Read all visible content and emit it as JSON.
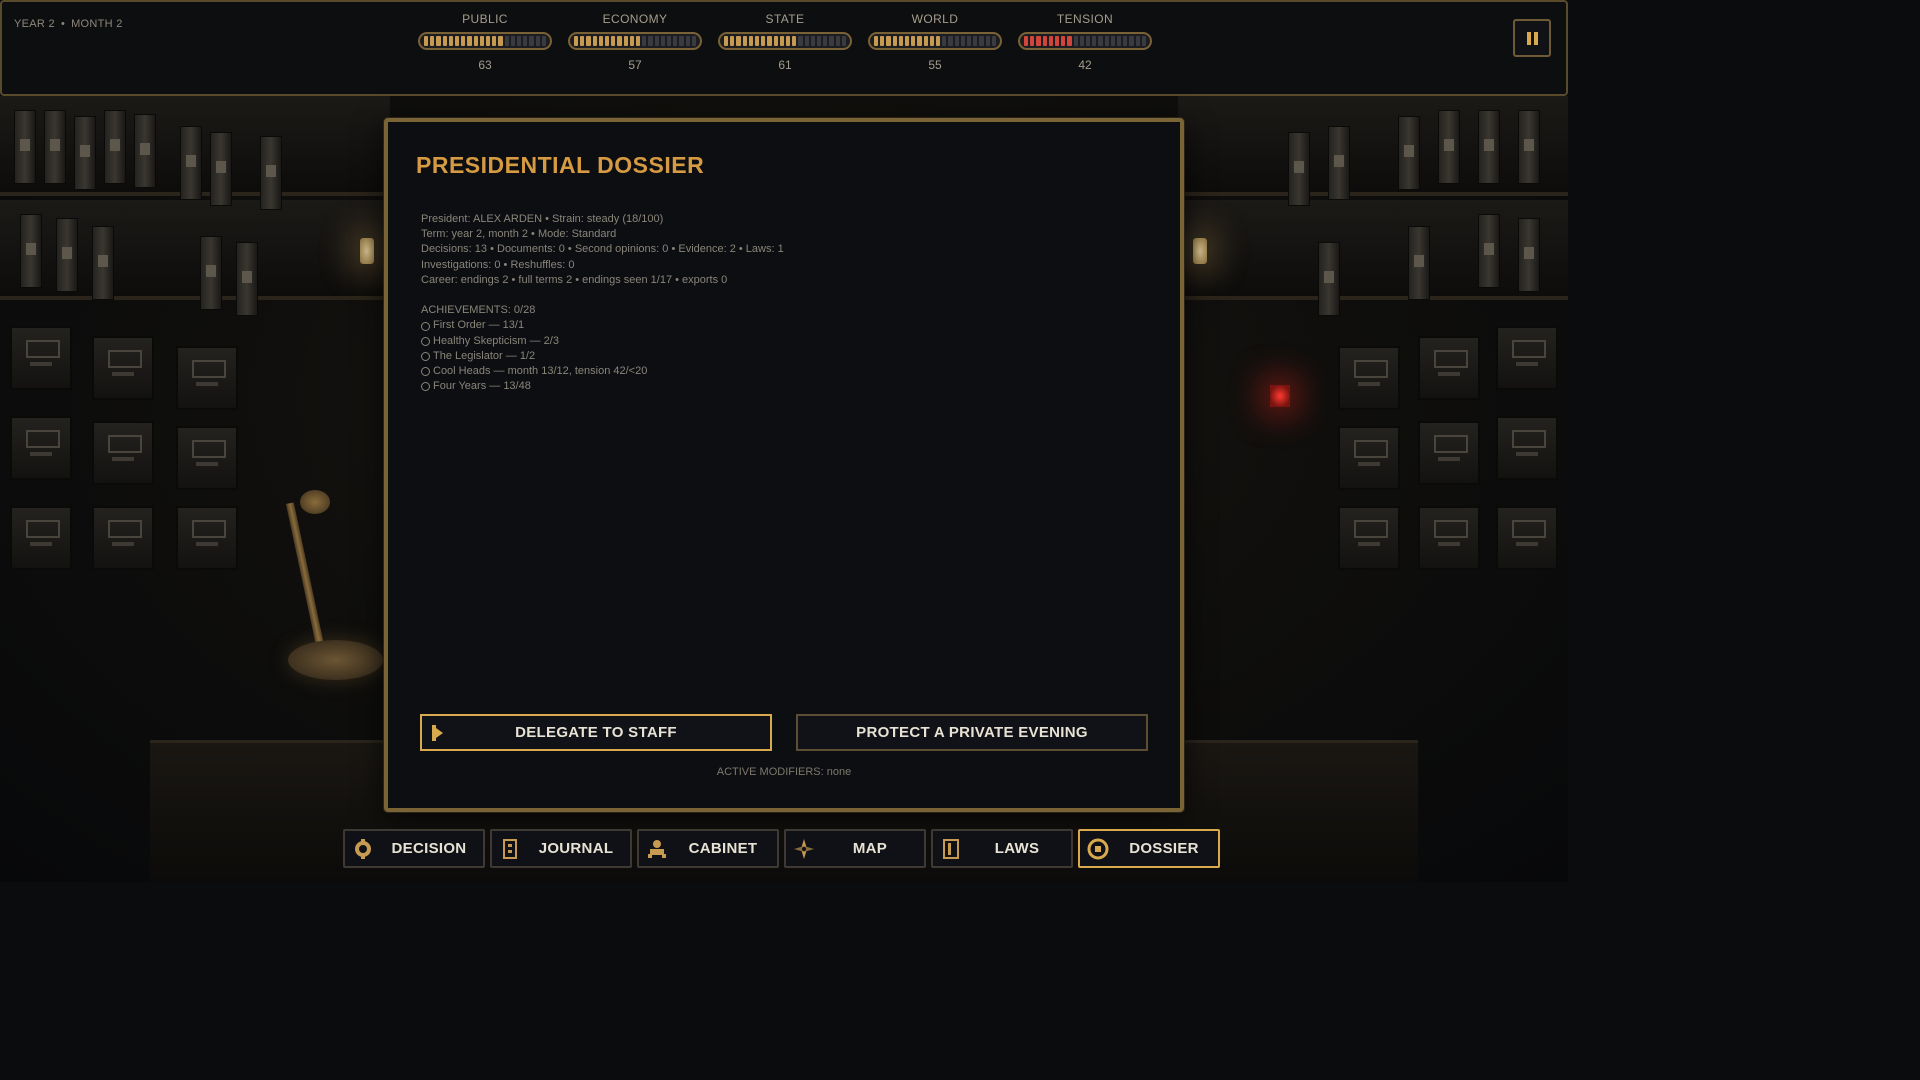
{
  "hud": {
    "year_label": "YEAR 2",
    "month_label": "MONTH 2",
    "meters": [
      {
        "label": "PUBLIC",
        "value": 63,
        "color": "#c79a52"
      },
      {
        "label": "ECONOMY",
        "value": 57,
        "color": "#c79a52"
      },
      {
        "label": "STATE",
        "value": 61,
        "color": "#c79a52"
      },
      {
        "label": "WORLD",
        "value": 55,
        "color": "#c79a52"
      },
      {
        "label": "TENSION",
        "value": 42,
        "color": "#d1453a"
      }
    ],
    "pause_icon": "pause-icon"
  },
  "dossier": {
    "title": "PRESIDENTIAL DOSSIER",
    "lines": [
      "President: ALEX ARDEN  •  Strain: steady (18/100)",
      "Term: year 2, month 2  •  Mode: Standard",
      "Decisions: 13  •  Documents: 0  •  Second opinions: 0  •  Evidence: 2  •  Laws: 1",
      "Investigations: 0  •  Reshuffles: 0",
      "Career: endings 2  •  full terms 2  •  endings seen 1/17  •  exports 0"
    ],
    "achievements_header": "ACHIEVEMENTS: 0/28",
    "achievements": [
      "First Order — 13/1",
      "Healthy Skepticism — 2/3",
      "The Legislator — 1/2",
      "Cool Heads — month 13/12, tension 42/<20",
      "Four Years — 13/48"
    ],
    "actions": {
      "delegate": "DELEGATE TO STAFF",
      "protect": "PROTECT A PRIVATE EVENING"
    },
    "modifiers": "ACTIVE MODIFIERS: none"
  },
  "nav": [
    {
      "label": "DECISION",
      "icon": "seal-icon"
    },
    {
      "label": "JOURNAL",
      "icon": "book-icon"
    },
    {
      "label": "CABINET",
      "icon": "people-icon"
    },
    {
      "label": "MAP",
      "icon": "compass-icon"
    },
    {
      "label": "LAWS",
      "icon": "scroll-icon"
    },
    {
      "label": "DOSSIER",
      "icon": "dossier-icon",
      "active": true
    }
  ],
  "colors": {
    "accent": "#d9a94e",
    "title": "#d59a42",
    "tension": "#d1453a"
  }
}
